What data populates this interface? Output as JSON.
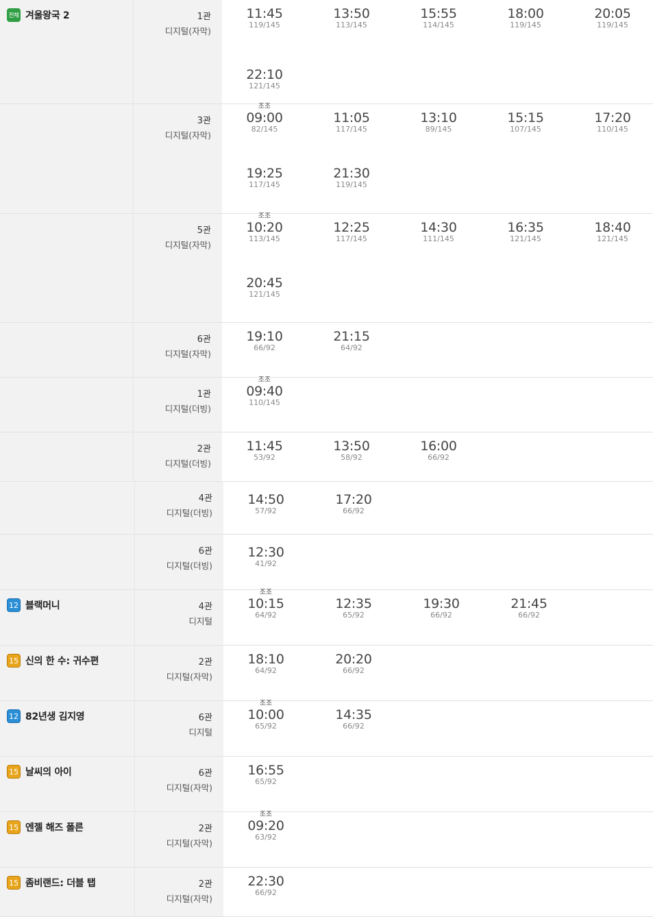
{
  "rows": [
    {
      "movie": {
        "title": "겨울왕국 2",
        "rating": "전체"
      },
      "hall": "1관",
      "format": "디지털(자막)",
      "times": [
        [
          {
            "time": "11:45",
            "seats": "119/145"
          },
          {
            "time": "13:50",
            "seats": "113/145"
          },
          {
            "time": "15:55",
            "seats": "114/145"
          },
          {
            "time": "18:00",
            "seats": "119/145"
          },
          {
            "time": "20:05",
            "seats": "119/145"
          }
        ],
        [
          {
            "time": "22:10",
            "seats": "121/145"
          }
        ]
      ]
    },
    {
      "movie": null,
      "hall": "3관",
      "format": "디지털(자막)",
      "times": [
        [
          {
            "time": "09:00",
            "seats": "82/145",
            "tag": "조조"
          },
          {
            "time": "11:05",
            "seats": "117/145"
          },
          {
            "time": "13:10",
            "seats": "89/145"
          },
          {
            "time": "15:15",
            "seats": "107/145"
          },
          {
            "time": "17:20",
            "seats": "110/145"
          }
        ],
        [
          {
            "time": "19:25",
            "seats": "117/145"
          },
          {
            "time": "21:30",
            "seats": "119/145"
          }
        ]
      ]
    },
    {
      "movie": null,
      "hall": "5관",
      "format": "디지털(자막)",
      "times": [
        [
          {
            "time": "10:20",
            "seats": "113/145",
            "tag": "조조"
          },
          {
            "time": "12:25",
            "seats": "117/145"
          },
          {
            "time": "14:30",
            "seats": "111/145"
          },
          {
            "time": "16:35",
            "seats": "121/145"
          },
          {
            "time": "18:40",
            "seats": "121/145"
          }
        ],
        [
          {
            "time": "20:45",
            "seats": "121/145"
          }
        ]
      ]
    },
    {
      "movie": null,
      "hall": "6관",
      "format": "디지털(자막)",
      "times": [
        [
          {
            "time": "19:10",
            "seats": "66/92"
          },
          {
            "time": "21:15",
            "seats": "64/92"
          }
        ]
      ]
    },
    {
      "movie": null,
      "hall": "1관",
      "format": "디지털(더빙)",
      "times": [
        [
          {
            "time": "09:40",
            "seats": "110/145",
            "tag": "조조"
          }
        ]
      ]
    },
    {
      "movie": null,
      "hall": "2관",
      "format": "디지털(더빙)",
      "times": [
        [
          {
            "time": "11:45",
            "seats": "53/92"
          },
          {
            "time": "13:50",
            "seats": "58/92"
          },
          {
            "time": "16:00",
            "seats": "66/92"
          }
        ]
      ]
    },
    {
      "movie": null,
      "hall": "4관",
      "format": "디지털(더빙)",
      "times": [
        [
          {
            "time": "14:50",
            "seats": "57/92"
          },
          {
            "time": "17:20",
            "seats": "66/92"
          }
        ]
      ]
    },
    {
      "movie": null,
      "hall": "6관",
      "format": "디지털(더빙)",
      "times": [
        [
          {
            "time": "12:30",
            "seats": "41/92"
          }
        ]
      ]
    },
    {
      "movie": {
        "title": "블랙머니",
        "rating": "12"
      },
      "hall": "4관",
      "format": "디지털",
      "times": [
        [
          {
            "time": "10:15",
            "seats": "64/92",
            "tag": "조조"
          },
          {
            "time": "12:35",
            "seats": "65/92"
          },
          {
            "time": "19:30",
            "seats": "66/92"
          },
          {
            "time": "21:45",
            "seats": "66/92"
          }
        ]
      ]
    },
    {
      "movie": {
        "title": "신의 한 수: 귀수편",
        "rating": "15"
      },
      "hall": "2관",
      "format": "디지털(자막)",
      "times": [
        [
          {
            "time": "18:10",
            "seats": "64/92"
          },
          {
            "time": "20:20",
            "seats": "66/92"
          }
        ]
      ]
    },
    {
      "movie": {
        "title": "82년생 김지영",
        "rating": "12"
      },
      "hall": "6관",
      "format": "디지털",
      "times": [
        [
          {
            "time": "10:00",
            "seats": "65/92",
            "tag": "조조"
          },
          {
            "time": "14:35",
            "seats": "66/92"
          }
        ]
      ]
    },
    {
      "movie": {
        "title": "날씨의 아이",
        "rating": "15"
      },
      "hall": "6관",
      "format": "디지털(자막)",
      "times": [
        [
          {
            "time": "16:55",
            "seats": "65/92"
          }
        ]
      ]
    },
    {
      "movie": {
        "title": "엔젤 해즈 폴른",
        "rating": "15"
      },
      "hall": "2관",
      "format": "디지털(자막)",
      "times": [
        [
          {
            "time": "09:20",
            "seats": "63/92",
            "tag": "조조"
          }
        ]
      ]
    },
    {
      "movie": {
        "title": "좀비랜드: 더블 탭",
        "rating": "15"
      },
      "hall": "2관",
      "format": "디지털(자막)",
      "times": [
        [
          {
            "time": "22:30",
            "seats": "66/92"
          }
        ]
      ]
    }
  ]
}
